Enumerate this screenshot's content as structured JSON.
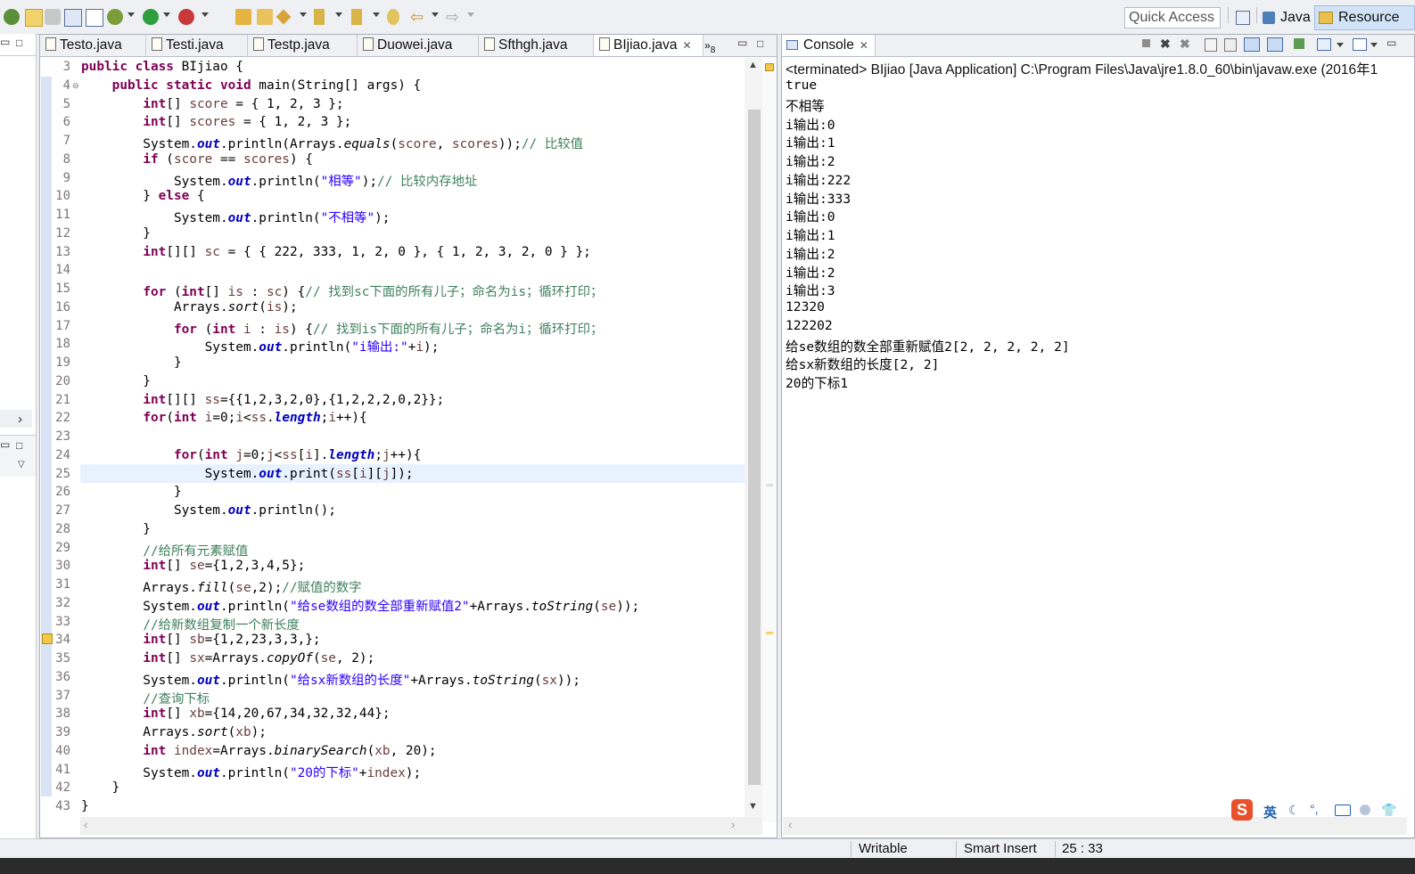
{
  "toolbar": {
    "quick_access_placeholder": "Quick Access",
    "perspectives": [
      {
        "label": "Java",
        "icon": "java-perspective-icon"
      },
      {
        "label": "Resource",
        "icon": "resource-perspective-icon"
      }
    ]
  },
  "editor": {
    "tabs": [
      {
        "label": "Testo.java"
      },
      {
        "label": "Testi.java"
      },
      {
        "label": "Testp.java"
      },
      {
        "label": "Duowei.java"
      },
      {
        "label": "Sfthgh.java"
      },
      {
        "label": "BIjiao.java",
        "active": true
      }
    ],
    "overflow_count": "8",
    "lines": [
      {
        "n": "3",
        "segs": [
          [
            "kw",
            "public class "
          ],
          [
            "",
            "BIjiao {"
          ]
        ]
      },
      {
        "n": "4",
        "segs": [
          [
            "",
            "    "
          ],
          [
            "kw",
            "public static void "
          ],
          [
            "",
            "main(String[] args) {"
          ]
        ]
      },
      {
        "n": "5",
        "segs": [
          [
            "",
            "        "
          ],
          [
            "kw",
            "int"
          ],
          [
            "",
            "[] "
          ],
          [
            "vr",
            "score"
          ],
          [
            "",
            " = { 1, 2, 3 };"
          ]
        ]
      },
      {
        "n": "6",
        "segs": [
          [
            "",
            "        "
          ],
          [
            "kw",
            "int"
          ],
          [
            "",
            "[] "
          ],
          [
            "vr",
            "scores"
          ],
          [
            "",
            " = { 1, 2, 3 };"
          ]
        ]
      },
      {
        "n": "7",
        "segs": [
          [
            "",
            "        System."
          ],
          [
            "fd",
            "out"
          ],
          [
            "",
            ".println(Arrays."
          ],
          [
            "it",
            "equals"
          ],
          [
            "",
            "("
          ],
          [
            "vr",
            "score"
          ],
          [
            "",
            ", "
          ],
          [
            "vr",
            "scores"
          ],
          [
            "",
            "));"
          ],
          [
            "cm",
            "// 比较值"
          ]
        ]
      },
      {
        "n": "8",
        "segs": [
          [
            "",
            "        "
          ],
          [
            "kw",
            "if"
          ],
          [
            "",
            " ("
          ],
          [
            "vr",
            "score"
          ],
          [
            "",
            " == "
          ],
          [
            "vr",
            "scores"
          ],
          [
            "",
            ") {"
          ]
        ]
      },
      {
        "n": "9",
        "segs": [
          [
            "",
            "            System."
          ],
          [
            "fd",
            "out"
          ],
          [
            "",
            ".println("
          ],
          [
            "st",
            "\"相等\""
          ],
          [
            "",
            ");"
          ],
          [
            "cm",
            "// 比较内存地址"
          ]
        ]
      },
      {
        "n": "10",
        "segs": [
          [
            "",
            "        } "
          ],
          [
            "kw",
            "else"
          ],
          [
            "",
            " {"
          ]
        ]
      },
      {
        "n": "11",
        "segs": [
          [
            "",
            "            System."
          ],
          [
            "fd",
            "out"
          ],
          [
            "",
            ".println("
          ],
          [
            "st",
            "\"不相等\""
          ],
          [
            "",
            ");"
          ]
        ]
      },
      {
        "n": "12",
        "segs": [
          [
            "",
            "        }"
          ]
        ]
      },
      {
        "n": "13",
        "segs": [
          [
            "",
            "        "
          ],
          [
            "kw",
            "int"
          ],
          [
            "",
            "[][] "
          ],
          [
            "vr",
            "sc"
          ],
          [
            "",
            " = { { 222, 333, 1, 2, 0 }, { 1, 2, 3, 2, 0 } };"
          ]
        ]
      },
      {
        "n": "14",
        "segs": [
          [
            "",
            ""
          ]
        ]
      },
      {
        "n": "15",
        "segs": [
          [
            "",
            "        "
          ],
          [
            "kw",
            "for"
          ],
          [
            "",
            " ("
          ],
          [
            "kw",
            "int"
          ],
          [
            "",
            "[] "
          ],
          [
            "vr",
            "is"
          ],
          [
            "",
            " : "
          ],
          [
            "vr",
            "sc"
          ],
          [
            "",
            ") {"
          ],
          [
            "cm",
            "// 找到sc下面的所有儿子；命名为is；循环打印；"
          ]
        ]
      },
      {
        "n": "16",
        "segs": [
          [
            "",
            "            Arrays."
          ],
          [
            "it",
            "sort"
          ],
          [
            "",
            "("
          ],
          [
            "vr",
            "is"
          ],
          [
            "",
            ");"
          ]
        ]
      },
      {
        "n": "17",
        "segs": [
          [
            "",
            "            "
          ],
          [
            "kw",
            "for"
          ],
          [
            "",
            " ("
          ],
          [
            "kw",
            "int"
          ],
          [
            "",
            " "
          ],
          [
            "vr",
            "i"
          ],
          [
            "",
            " : "
          ],
          [
            "vr",
            "is"
          ],
          [
            "",
            ") {"
          ],
          [
            "cm",
            "// 找到is下面的所有儿子；命名为i；循环打印；"
          ]
        ]
      },
      {
        "n": "18",
        "segs": [
          [
            "",
            "                System."
          ],
          [
            "fd",
            "out"
          ],
          [
            "",
            ".println("
          ],
          [
            "st",
            "\"i输出:\""
          ],
          [
            "",
            "+"
          ],
          [
            "vr",
            "i"
          ],
          [
            "",
            ");"
          ]
        ]
      },
      {
        "n": "19",
        "segs": [
          [
            "",
            "            }"
          ]
        ]
      },
      {
        "n": "20",
        "segs": [
          [
            "",
            "        }"
          ]
        ]
      },
      {
        "n": "21",
        "segs": [
          [
            "",
            "        "
          ],
          [
            "kw",
            "int"
          ],
          [
            "",
            "[][] "
          ],
          [
            "vr",
            "ss"
          ],
          [
            "",
            "={{1,2,3,2,0},{1,2,2,2,0,2}};"
          ]
        ]
      },
      {
        "n": "22",
        "segs": [
          [
            "",
            "        "
          ],
          [
            "kw",
            "for"
          ],
          [
            "",
            "("
          ],
          [
            "kw",
            "int"
          ],
          [
            "",
            " "
          ],
          [
            "vr",
            "i"
          ],
          [
            "",
            "=0;"
          ],
          [
            "vr",
            "i"
          ],
          [
            "",
            "<"
          ],
          [
            "vr",
            "ss"
          ],
          [
            "",
            "."
          ],
          [
            "fd",
            "length"
          ],
          [
            "",
            ";"
          ],
          [
            "vr",
            "i"
          ],
          [
            "",
            "++){"
          ]
        ]
      },
      {
        "n": "23",
        "segs": [
          [
            "",
            ""
          ]
        ]
      },
      {
        "n": "24",
        "segs": [
          [
            "",
            "            "
          ],
          [
            "kw",
            "for"
          ],
          [
            "",
            "("
          ],
          [
            "kw",
            "int"
          ],
          [
            "",
            " "
          ],
          [
            "vr",
            "j"
          ],
          [
            "",
            "=0;"
          ],
          [
            "vr",
            "j"
          ],
          [
            "",
            "<"
          ],
          [
            "vr",
            "ss"
          ],
          [
            "",
            "["
          ],
          [
            "vr",
            "i"
          ],
          [
            "",
            "]."
          ],
          [
            "fd",
            "length"
          ],
          [
            "",
            ";"
          ],
          [
            "vr",
            "j"
          ],
          [
            "",
            "++){"
          ]
        ]
      },
      {
        "n": "25",
        "segs": [
          [
            "",
            "                System."
          ],
          [
            "fd",
            "out"
          ],
          [
            "",
            ".print("
          ],
          [
            "vr",
            "ss"
          ],
          [
            "",
            "["
          ],
          [
            "vr",
            "i"
          ],
          [
            "",
            "]["
          ],
          [
            "vr",
            "j"
          ],
          [
            "",
            "]);"
          ]
        ]
      },
      {
        "n": "26",
        "segs": [
          [
            "",
            "            }"
          ]
        ]
      },
      {
        "n": "27",
        "segs": [
          [
            "",
            "            System."
          ],
          [
            "fd",
            "out"
          ],
          [
            "",
            ".println();"
          ]
        ]
      },
      {
        "n": "28",
        "segs": [
          [
            "",
            "        }"
          ]
        ]
      },
      {
        "n": "29",
        "segs": [
          [
            "",
            "        "
          ],
          [
            "cm",
            "//给所有元素赋值"
          ]
        ]
      },
      {
        "n": "30",
        "segs": [
          [
            "",
            "        "
          ],
          [
            "kw",
            "int"
          ],
          [
            "",
            "[] "
          ],
          [
            "vr",
            "se"
          ],
          [
            "",
            "={1,2,3,4,5};"
          ]
        ]
      },
      {
        "n": "31",
        "segs": [
          [
            "",
            "        Arrays."
          ],
          [
            "it",
            "fill"
          ],
          [
            "",
            "("
          ],
          [
            "vr",
            "se"
          ],
          [
            "",
            ",2);"
          ],
          [
            "cm",
            "//赋值的数字"
          ]
        ]
      },
      {
        "n": "32",
        "segs": [
          [
            "",
            "        System."
          ],
          [
            "fd",
            "out"
          ],
          [
            "",
            ".println("
          ],
          [
            "st",
            "\"给se数组的数全部重新赋值2\""
          ],
          [
            "",
            "+Arrays."
          ],
          [
            "it",
            "toString"
          ],
          [
            "",
            "("
          ],
          [
            "vr",
            "se"
          ],
          [
            "",
            "));"
          ]
        ]
      },
      {
        "n": "33",
        "segs": [
          [
            "",
            "        "
          ],
          [
            "cm",
            "//给新数组复制一个新长度"
          ]
        ]
      },
      {
        "n": "34",
        "segs": [
          [
            "",
            "        "
          ],
          [
            "kw",
            "int"
          ],
          [
            "",
            "[] "
          ],
          [
            "vr",
            "sb"
          ],
          [
            "",
            "={1,2,23,3,3,};"
          ]
        ]
      },
      {
        "n": "35",
        "segs": [
          [
            "",
            "        "
          ],
          [
            "kw",
            "int"
          ],
          [
            "",
            "[] "
          ],
          [
            "vr",
            "sx"
          ],
          [
            "",
            "=Arrays."
          ],
          [
            "it",
            "copyOf"
          ],
          [
            "",
            "("
          ],
          [
            "vr",
            "se"
          ],
          [
            "",
            ", 2);"
          ]
        ]
      },
      {
        "n": "36",
        "segs": [
          [
            "",
            "        System."
          ],
          [
            "fd",
            "out"
          ],
          [
            "",
            ".println("
          ],
          [
            "st",
            "\"给sx新数组的长度\""
          ],
          [
            "",
            "+Arrays."
          ],
          [
            "it",
            "toString"
          ],
          [
            "",
            "("
          ],
          [
            "vr",
            "sx"
          ],
          [
            "",
            "));"
          ]
        ]
      },
      {
        "n": "37",
        "segs": [
          [
            "",
            "        "
          ],
          [
            "cm",
            "//查询下标"
          ]
        ]
      },
      {
        "n": "38",
        "segs": [
          [
            "",
            "        "
          ],
          [
            "kw",
            "int"
          ],
          [
            "",
            "[] "
          ],
          [
            "vr",
            "xb"
          ],
          [
            "",
            "={14,20,67,34,32,32,44};"
          ]
        ]
      },
      {
        "n": "39",
        "segs": [
          [
            "",
            "        Arrays."
          ],
          [
            "it",
            "sort"
          ],
          [
            "",
            "("
          ],
          [
            "vr",
            "xb"
          ],
          [
            "",
            ");"
          ]
        ]
      },
      {
        "n": "40",
        "segs": [
          [
            "",
            "        "
          ],
          [
            "kw",
            "int"
          ],
          [
            "",
            " "
          ],
          [
            "vr",
            "index"
          ],
          [
            "",
            "=Arrays."
          ],
          [
            "it",
            "binarySearch"
          ],
          [
            "",
            "("
          ],
          [
            "vr",
            "xb"
          ],
          [
            "",
            ", 20);"
          ]
        ]
      },
      {
        "n": "41",
        "segs": [
          [
            "",
            "        System."
          ],
          [
            "fd",
            "out"
          ],
          [
            "",
            ".println("
          ],
          [
            "st",
            "\"20的下标\""
          ],
          [
            "",
            "+"
          ],
          [
            "vr",
            "index"
          ],
          [
            "",
            ");"
          ]
        ]
      },
      {
        "n": "42",
        "segs": [
          [
            "",
            "    }"
          ]
        ]
      },
      {
        "n": "43",
        "segs": [
          [
            "",
            "}"
          ]
        ]
      }
    ]
  },
  "console": {
    "tab_label": "Console",
    "header": "<terminated> BIjiao [Java Application] C:\\Program Files\\Java\\jre1.8.0_60\\bin\\javaw.exe (2016年1",
    "lines": [
      "true",
      "不相等",
      "i输出:0",
      "i输出:1",
      "i输出:2",
      "i输出:222",
      "i输出:333",
      "i输出:0",
      "i输出:1",
      "i输出:2",
      "i输出:2",
      "i输出:3",
      "12320",
      "122202",
      "给se数组的数全部重新赋值2[2, 2, 2, 2, 2]",
      "给sx新数组的长度[2, 2]",
      "20的下标1"
    ]
  },
  "status": {
    "writable": "Writable",
    "insert_mode": "Smart Insert",
    "position": "25 : 33"
  },
  "ime": {
    "lang": "英"
  }
}
